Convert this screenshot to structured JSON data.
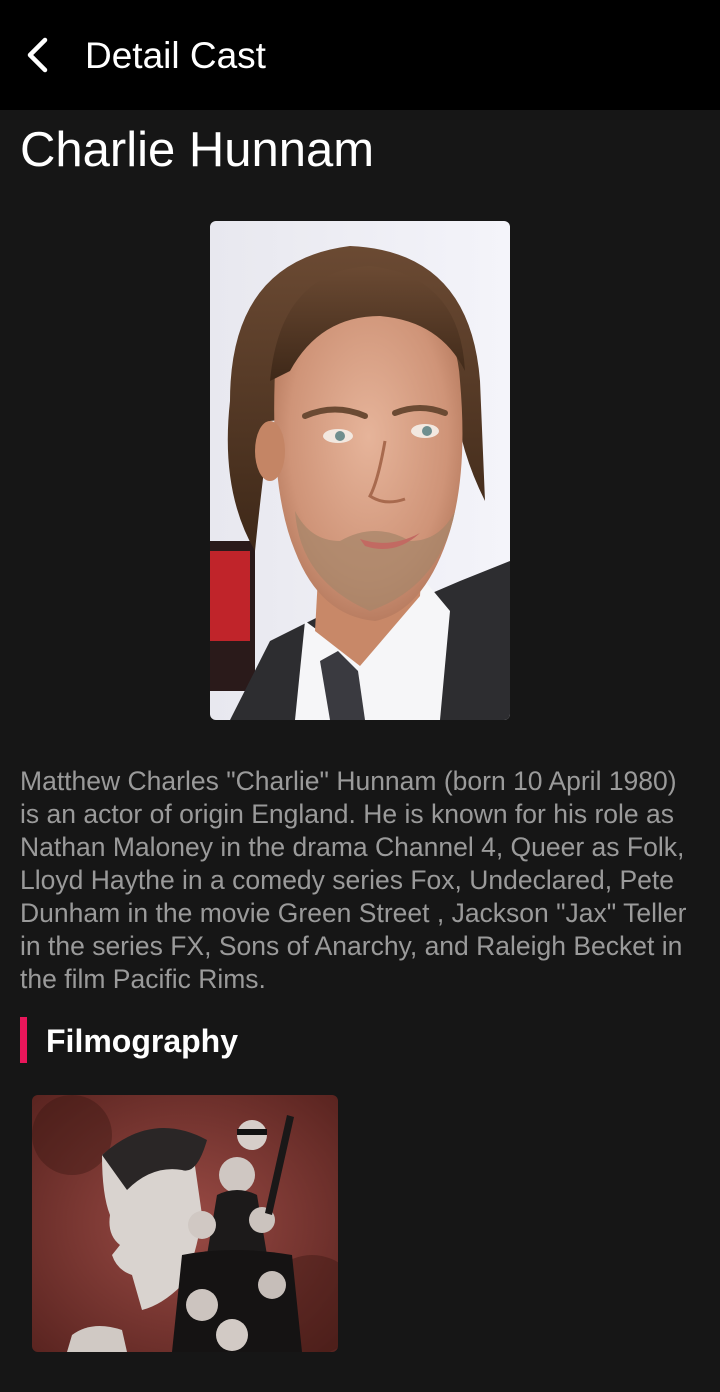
{
  "appbar": {
    "title": "Detail Cast",
    "back_icon": "chevron-left-icon"
  },
  "cast": {
    "name": "Charlie Hunnam",
    "photo_alt": "Charlie Hunnam",
    "bio": "Matthew Charles \"Charlie\" Hunnam (born 10 April 1980) is an actor of origin England. He is known for his role as Nathan Maloney in the drama Channel 4, Queer as Folk, Lloyd Haythe in a comedy series Fox, Undeclared, Pete Dunham in the movie Green Street , Jackson \"Jax\" Teller in the series FX, Sons of Anarchy, and Raleigh Becket in the film Pacific Rims."
  },
  "filmography": {
    "title": "Filmography",
    "accent_color": "#e9165a",
    "items": [
      {
        "poster": "sons-of-anarchy-poster"
      }
    ]
  },
  "colors": {
    "background": "#161616",
    "appbar": "#000000",
    "text_primary": "#ffffff",
    "text_secondary": "#9a9a9a"
  }
}
